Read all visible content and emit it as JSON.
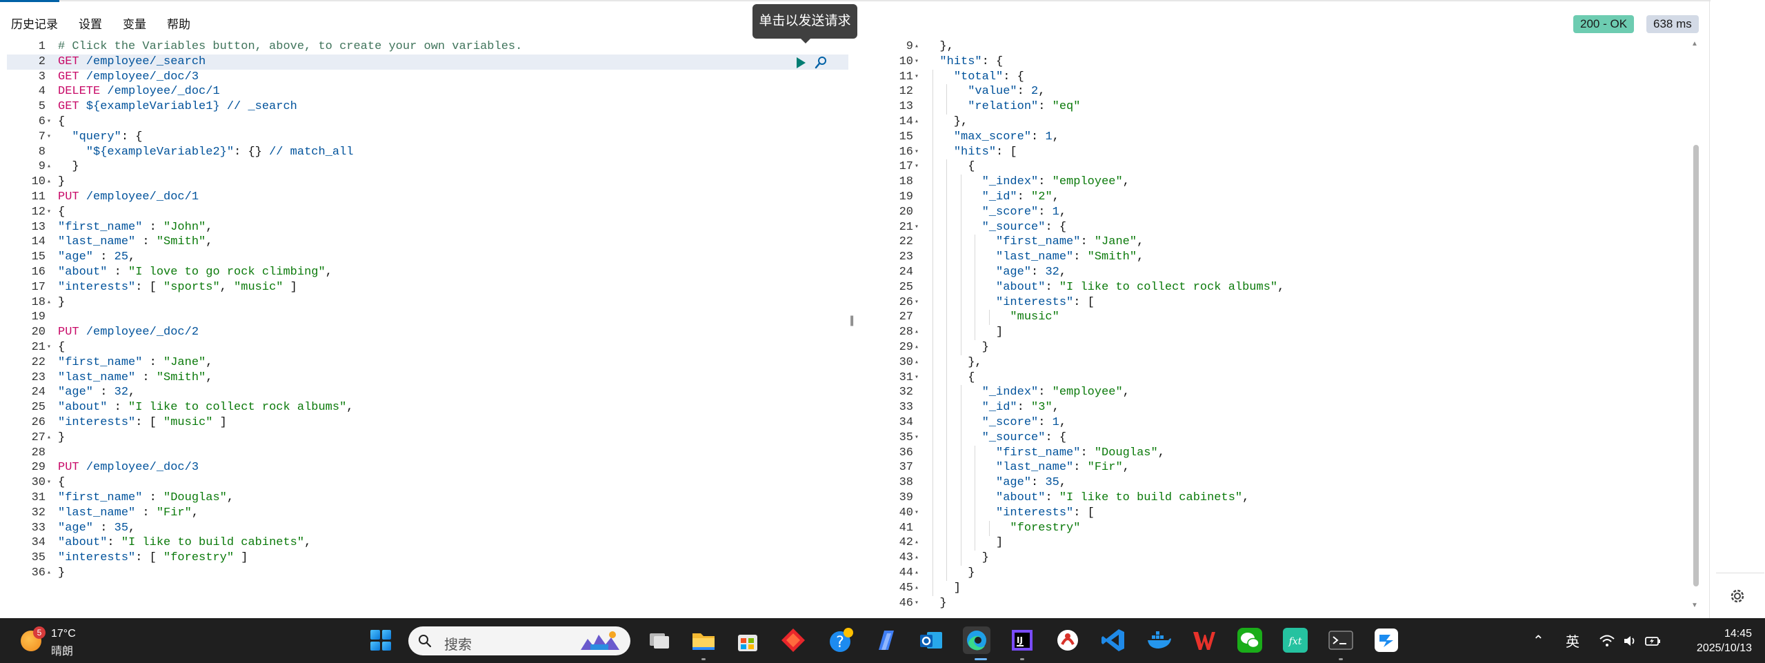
{
  "menu": {
    "history": "历史记录",
    "settings": "设置",
    "variables": "变量",
    "help": "帮助"
  },
  "response_status": {
    "code": "200 - OK",
    "time": "638 ms"
  },
  "tooltip": "单击以发送请求",
  "request_lines": [
    {
      "n": "1",
      "fold": "",
      "segs": [
        [
          "comment",
          "# Click the Variables button, above, to create your own variables."
        ]
      ]
    },
    {
      "n": "2",
      "fold": "",
      "active": true,
      "segs": [
        [
          "method",
          "GET "
        ],
        [
          "url",
          "/employee/_search"
        ]
      ]
    },
    {
      "n": "3",
      "fold": "",
      "segs": [
        [
          "method",
          "GET "
        ],
        [
          "url",
          "/employee/_doc/3"
        ]
      ]
    },
    {
      "n": "4",
      "fold": "",
      "segs": [
        [
          "method",
          "DELETE "
        ],
        [
          "url",
          "/employee/_doc/1"
        ]
      ]
    },
    {
      "n": "5",
      "fold": "",
      "segs": [
        [
          "method",
          "GET "
        ],
        [
          "url",
          "${exampleVariable1} // _search"
        ]
      ]
    },
    {
      "n": "6",
      "fold": "▾",
      "segs": [
        [
          "punc",
          "{"
        ]
      ]
    },
    {
      "n": "7",
      "fold": "▾",
      "segs": [
        [
          "punc",
          "  "
        ],
        [
          "key",
          "\"query\""
        ],
        [
          "punc",
          ": {"
        ]
      ]
    },
    {
      "n": "8",
      "fold": "",
      "segs": [
        [
          "punc",
          "    "
        ],
        [
          "key",
          "\"${exampleVariable2}\""
        ],
        [
          "punc",
          ": {} "
        ],
        [
          "url",
          "// match_all"
        ]
      ]
    },
    {
      "n": "9",
      "fold": "▴",
      "segs": [
        [
          "punc",
          "  }"
        ]
      ]
    },
    {
      "n": "10",
      "fold": "▴",
      "segs": [
        [
          "punc",
          "}"
        ]
      ]
    },
    {
      "n": "11",
      "fold": "",
      "segs": [
        [
          "method",
          "PUT "
        ],
        [
          "url",
          "/employee/_doc/1"
        ]
      ]
    },
    {
      "n": "12",
      "fold": "▾",
      "segs": [
        [
          "punc",
          "{"
        ]
      ]
    },
    {
      "n": "13",
      "fold": "",
      "segs": [
        [
          "key",
          "\"first_name\""
        ],
        [
          "punc",
          " : "
        ],
        [
          "str",
          "\"John\""
        ],
        [
          "punc",
          ","
        ]
      ]
    },
    {
      "n": "14",
      "fold": "",
      "segs": [
        [
          "key",
          "\"last_name\""
        ],
        [
          "punc",
          " : "
        ],
        [
          "str",
          "\"Smith\""
        ],
        [
          "punc",
          ","
        ]
      ]
    },
    {
      "n": "15",
      "fold": "",
      "segs": [
        [
          "key",
          "\"age\""
        ],
        [
          "punc",
          " : "
        ],
        [
          "num",
          "25"
        ],
        [
          "punc",
          ","
        ]
      ]
    },
    {
      "n": "16",
      "fold": "",
      "segs": [
        [
          "key",
          "\"about\""
        ],
        [
          "punc",
          " : "
        ],
        [
          "str",
          "\"I love to go rock climbing\""
        ],
        [
          "punc",
          ","
        ]
      ]
    },
    {
      "n": "17",
      "fold": "",
      "segs": [
        [
          "key",
          "\"interests\""
        ],
        [
          "punc",
          ": [ "
        ],
        [
          "str",
          "\"sports\""
        ],
        [
          "punc",
          ", "
        ],
        [
          "str",
          "\"music\""
        ],
        [
          "punc",
          " ]"
        ]
      ]
    },
    {
      "n": "18",
      "fold": "▴",
      "segs": [
        [
          "punc",
          "}"
        ]
      ]
    },
    {
      "n": "19",
      "fold": "",
      "segs": []
    },
    {
      "n": "20",
      "fold": "",
      "segs": [
        [
          "method",
          "PUT "
        ],
        [
          "url",
          "/employee/_doc/2"
        ]
      ]
    },
    {
      "n": "21",
      "fold": "▾",
      "segs": [
        [
          "punc",
          "{"
        ]
      ]
    },
    {
      "n": "22",
      "fold": "",
      "segs": [
        [
          "key",
          "\"first_name\""
        ],
        [
          "punc",
          " : "
        ],
        [
          "str",
          "\"Jane\""
        ],
        [
          "punc",
          ","
        ]
      ]
    },
    {
      "n": "23",
      "fold": "",
      "segs": [
        [
          "key",
          "\"last_name\""
        ],
        [
          "punc",
          " : "
        ],
        [
          "str",
          "\"Smith\""
        ],
        [
          "punc",
          ","
        ]
      ]
    },
    {
      "n": "24",
      "fold": "",
      "segs": [
        [
          "key",
          "\"age\""
        ],
        [
          "punc",
          " : "
        ],
        [
          "num",
          "32"
        ],
        [
          "punc",
          ","
        ]
      ]
    },
    {
      "n": "25",
      "fold": "",
      "segs": [
        [
          "key",
          "\"about\""
        ],
        [
          "punc",
          " : "
        ],
        [
          "str",
          "\"I like to collect rock albums\""
        ],
        [
          "punc",
          ","
        ]
      ]
    },
    {
      "n": "26",
      "fold": "",
      "segs": [
        [
          "key",
          "\"interests\""
        ],
        [
          "punc",
          ": [ "
        ],
        [
          "str",
          "\"music\""
        ],
        [
          "punc",
          " ]"
        ]
      ]
    },
    {
      "n": "27",
      "fold": "▴",
      "segs": [
        [
          "punc",
          "}"
        ]
      ]
    },
    {
      "n": "28",
      "fold": "",
      "segs": []
    },
    {
      "n": "29",
      "fold": "",
      "segs": [
        [
          "method",
          "PUT "
        ],
        [
          "url",
          "/employee/_doc/3"
        ]
      ]
    },
    {
      "n": "30",
      "fold": "▾",
      "segs": [
        [
          "punc",
          "{"
        ]
      ]
    },
    {
      "n": "31",
      "fold": "",
      "segs": [
        [
          "key",
          "\"first_name\""
        ],
        [
          "punc",
          " : "
        ],
        [
          "str",
          "\"Douglas\""
        ],
        [
          "punc",
          ","
        ]
      ]
    },
    {
      "n": "32",
      "fold": "",
      "segs": [
        [
          "key",
          "\"last_name\""
        ],
        [
          "punc",
          " : "
        ],
        [
          "str",
          "\"Fir\""
        ],
        [
          "punc",
          ","
        ]
      ]
    },
    {
      "n": "33",
      "fold": "",
      "segs": [
        [
          "key",
          "\"age\""
        ],
        [
          "punc",
          " : "
        ],
        [
          "num",
          "35"
        ],
        [
          "punc",
          ","
        ]
      ]
    },
    {
      "n": "34",
      "fold": "",
      "segs": [
        [
          "key",
          "\"about\""
        ],
        [
          "punc",
          ": "
        ],
        [
          "str",
          "\"I like to build cabinets\""
        ],
        [
          "punc",
          ","
        ]
      ]
    },
    {
      "n": "35",
      "fold": "",
      "segs": [
        [
          "key",
          "\"interests\""
        ],
        [
          "punc",
          ": [ "
        ],
        [
          "str",
          "\"forestry\""
        ],
        [
          "punc",
          " ]"
        ]
      ]
    },
    {
      "n": "36",
      "fold": "▴",
      "segs": [
        [
          "punc",
          "}"
        ]
      ]
    }
  ],
  "response_lines": [
    {
      "n": "9",
      "fold": "▴",
      "lvl": 0,
      "segs": [
        [
          "punc",
          "  },"
        ]
      ]
    },
    {
      "n": "10",
      "fold": "▾",
      "lvl": 0,
      "segs": [
        [
          "punc",
          "  "
        ],
        [
          "key",
          "\"hits\""
        ],
        [
          "punc",
          ": {"
        ]
      ]
    },
    {
      "n": "11",
      "fold": "▾",
      "lvl": 1,
      "segs": [
        [
          "punc",
          "    "
        ],
        [
          "key",
          "\"total\""
        ],
        [
          "punc",
          ": {"
        ]
      ]
    },
    {
      "n": "12",
      "fold": "",
      "lvl": 2,
      "segs": [
        [
          "punc",
          "      "
        ],
        [
          "key",
          "\"value\""
        ],
        [
          "punc",
          ": "
        ],
        [
          "num",
          "2"
        ],
        [
          "punc",
          ","
        ]
      ]
    },
    {
      "n": "13",
      "fold": "",
      "lvl": 2,
      "segs": [
        [
          "punc",
          "      "
        ],
        [
          "key",
          "\"relation\""
        ],
        [
          "punc",
          ": "
        ],
        [
          "str",
          "\"eq\""
        ]
      ]
    },
    {
      "n": "14",
      "fold": "▴",
      "lvl": 1,
      "segs": [
        [
          "punc",
          "    },"
        ]
      ]
    },
    {
      "n": "15",
      "fold": "",
      "lvl": 1,
      "segs": [
        [
          "punc",
          "    "
        ],
        [
          "key",
          "\"max_score\""
        ],
        [
          "punc",
          ": "
        ],
        [
          "num",
          "1"
        ],
        [
          "punc",
          ","
        ]
      ]
    },
    {
      "n": "16",
      "fold": "▾",
      "lvl": 1,
      "segs": [
        [
          "punc",
          "    "
        ],
        [
          "key",
          "\"hits\""
        ],
        [
          "punc",
          ": ["
        ]
      ]
    },
    {
      "n": "17",
      "fold": "▾",
      "lvl": 2,
      "segs": [
        [
          "punc",
          "      {"
        ]
      ]
    },
    {
      "n": "18",
      "fold": "",
      "lvl": 3,
      "segs": [
        [
          "punc",
          "        "
        ],
        [
          "key",
          "\"_index\""
        ],
        [
          "punc",
          ": "
        ],
        [
          "str",
          "\"employee\""
        ],
        [
          "punc",
          ","
        ]
      ]
    },
    {
      "n": "19",
      "fold": "",
      "lvl": 3,
      "segs": [
        [
          "punc",
          "        "
        ],
        [
          "key",
          "\"_id\""
        ],
        [
          "punc",
          ": "
        ],
        [
          "str",
          "\"2\""
        ],
        [
          "punc",
          ","
        ]
      ]
    },
    {
      "n": "20",
      "fold": "",
      "lvl": 3,
      "segs": [
        [
          "punc",
          "        "
        ],
        [
          "key",
          "\"_score\""
        ],
        [
          "punc",
          ": "
        ],
        [
          "num",
          "1"
        ],
        [
          "punc",
          ","
        ]
      ]
    },
    {
      "n": "21",
      "fold": "▾",
      "lvl": 3,
      "segs": [
        [
          "punc",
          "        "
        ],
        [
          "key",
          "\"_source\""
        ],
        [
          "punc",
          ": {"
        ]
      ]
    },
    {
      "n": "22",
      "fold": "",
      "lvl": 4,
      "segs": [
        [
          "punc",
          "          "
        ],
        [
          "key",
          "\"first_name\""
        ],
        [
          "punc",
          ": "
        ],
        [
          "str",
          "\"Jane\""
        ],
        [
          "punc",
          ","
        ]
      ]
    },
    {
      "n": "23",
      "fold": "",
      "lvl": 4,
      "segs": [
        [
          "punc",
          "          "
        ],
        [
          "key",
          "\"last_name\""
        ],
        [
          "punc",
          ": "
        ],
        [
          "str",
          "\"Smith\""
        ],
        [
          "punc",
          ","
        ]
      ]
    },
    {
      "n": "24",
      "fold": "",
      "lvl": 4,
      "segs": [
        [
          "punc",
          "          "
        ],
        [
          "key",
          "\"age\""
        ],
        [
          "punc",
          ": "
        ],
        [
          "num",
          "32"
        ],
        [
          "punc",
          ","
        ]
      ]
    },
    {
      "n": "25",
      "fold": "",
      "lvl": 4,
      "segs": [
        [
          "punc",
          "          "
        ],
        [
          "key",
          "\"about\""
        ],
        [
          "punc",
          ": "
        ],
        [
          "str",
          "\"I like to collect rock albums\""
        ],
        [
          "punc",
          ","
        ]
      ]
    },
    {
      "n": "26",
      "fold": "▾",
      "lvl": 4,
      "segs": [
        [
          "punc",
          "          "
        ],
        [
          "key",
          "\"interests\""
        ],
        [
          "punc",
          ": ["
        ]
      ]
    },
    {
      "n": "27",
      "fold": "",
      "lvl": 5,
      "segs": [
        [
          "punc",
          "            "
        ],
        [
          "str",
          "\"music\""
        ]
      ]
    },
    {
      "n": "28",
      "fold": "▴",
      "lvl": 4,
      "segs": [
        [
          "punc",
          "          ]"
        ]
      ]
    },
    {
      "n": "29",
      "fold": "▴",
      "lvl": 3,
      "segs": [
        [
          "punc",
          "        }"
        ]
      ]
    },
    {
      "n": "30",
      "fold": "▴",
      "lvl": 2,
      "segs": [
        [
          "punc",
          "      },"
        ]
      ]
    },
    {
      "n": "31",
      "fold": "▾",
      "lvl": 2,
      "segs": [
        [
          "punc",
          "      {"
        ]
      ]
    },
    {
      "n": "32",
      "fold": "",
      "lvl": 3,
      "segs": [
        [
          "punc",
          "        "
        ],
        [
          "key",
          "\"_index\""
        ],
        [
          "punc",
          ": "
        ],
        [
          "str",
          "\"employee\""
        ],
        [
          "punc",
          ","
        ]
      ]
    },
    {
      "n": "33",
      "fold": "",
      "lvl": 3,
      "segs": [
        [
          "punc",
          "        "
        ],
        [
          "key",
          "\"_id\""
        ],
        [
          "punc",
          ": "
        ],
        [
          "str",
          "\"3\""
        ],
        [
          "punc",
          ","
        ]
      ]
    },
    {
      "n": "34",
      "fold": "",
      "lvl": 3,
      "segs": [
        [
          "punc",
          "        "
        ],
        [
          "key",
          "\"_score\""
        ],
        [
          "punc",
          ": "
        ],
        [
          "num",
          "1"
        ],
        [
          "punc",
          ","
        ]
      ]
    },
    {
      "n": "35",
      "fold": "▾",
      "lvl": 3,
      "segs": [
        [
          "punc",
          "        "
        ],
        [
          "key",
          "\"_source\""
        ],
        [
          "punc",
          ": {"
        ]
      ]
    },
    {
      "n": "36",
      "fold": "",
      "lvl": 4,
      "segs": [
        [
          "punc",
          "          "
        ],
        [
          "key",
          "\"first_name\""
        ],
        [
          "punc",
          ": "
        ],
        [
          "str",
          "\"Douglas\""
        ],
        [
          "punc",
          ","
        ]
      ]
    },
    {
      "n": "37",
      "fold": "",
      "lvl": 4,
      "segs": [
        [
          "punc",
          "          "
        ],
        [
          "key",
          "\"last_name\""
        ],
        [
          "punc",
          ": "
        ],
        [
          "str",
          "\"Fir\""
        ],
        [
          "punc",
          ","
        ]
      ]
    },
    {
      "n": "38",
      "fold": "",
      "lvl": 4,
      "segs": [
        [
          "punc",
          "          "
        ],
        [
          "key",
          "\"age\""
        ],
        [
          "punc",
          ": "
        ],
        [
          "num",
          "35"
        ],
        [
          "punc",
          ","
        ]
      ]
    },
    {
      "n": "39",
      "fold": "",
      "lvl": 4,
      "segs": [
        [
          "punc",
          "          "
        ],
        [
          "key",
          "\"about\""
        ],
        [
          "punc",
          ": "
        ],
        [
          "str",
          "\"I like to build cabinets\""
        ],
        [
          "punc",
          ","
        ]
      ]
    },
    {
      "n": "40",
      "fold": "▾",
      "lvl": 4,
      "segs": [
        [
          "punc",
          "          "
        ],
        [
          "key",
          "\"interests\""
        ],
        [
          "punc",
          ": ["
        ]
      ]
    },
    {
      "n": "41",
      "fold": "",
      "lvl": 5,
      "segs": [
        [
          "punc",
          "            "
        ],
        [
          "str",
          "\"forestry\""
        ]
      ]
    },
    {
      "n": "42",
      "fold": "▴",
      "lvl": 4,
      "segs": [
        [
          "punc",
          "          ]"
        ]
      ]
    },
    {
      "n": "43",
      "fold": "▴",
      "lvl": 3,
      "segs": [
        [
          "punc",
          "        }"
        ]
      ]
    },
    {
      "n": "44",
      "fold": "▴",
      "lvl": 2,
      "segs": [
        [
          "punc",
          "      }"
        ]
      ]
    },
    {
      "n": "45",
      "fold": "▴",
      "lvl": 1,
      "segs": [
        [
          "punc",
          "    ]"
        ]
      ]
    },
    {
      "n": "46",
      "fold": "▾",
      "lvl": 0,
      "segs": [
        [
          "punc",
          "  }"
        ]
      ]
    }
  ],
  "taskbar": {
    "weather_temp": "17°C",
    "weather_desc": "晴朗",
    "weather_badge": "5",
    "search_placeholder": "搜索",
    "ime": "英",
    "time": "14:45",
    "date": "2025/10/13"
  },
  "colors": {
    "status_ok": "#6dccb1",
    "status_time": "#d3dae6",
    "method": "#c80a68",
    "key": "#00529b",
    "string": "#0b7a0b",
    "accent": "#0061a6"
  }
}
